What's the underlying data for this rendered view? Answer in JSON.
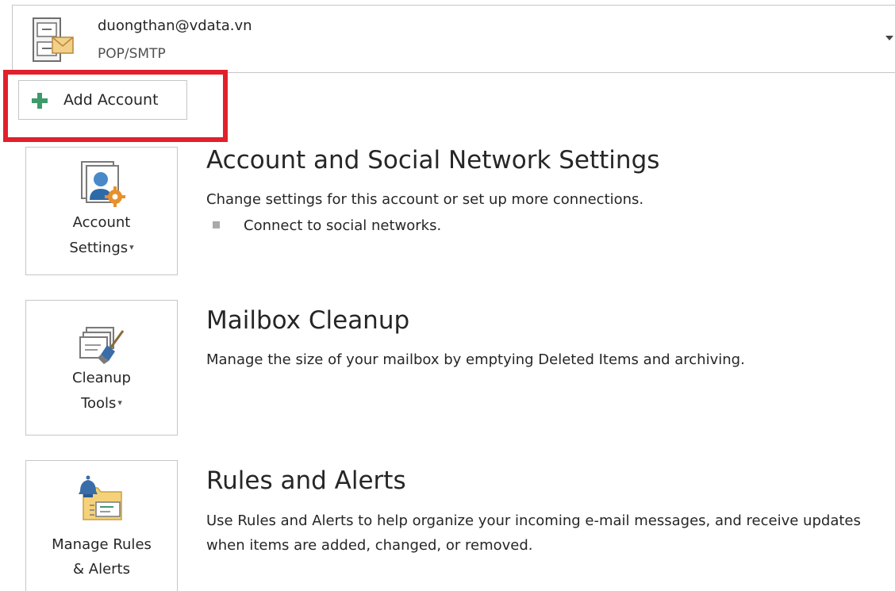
{
  "account": {
    "email": "duongthan@vdata.vn",
    "type": "POP/SMTP"
  },
  "add_account": {
    "label": "Add Account"
  },
  "sections": [
    {
      "button_label_line1": "Account",
      "button_label_line2": "Settings",
      "title": "Account and Social Network Settings",
      "description": "Change settings for this account or set up more connections.",
      "bullets": [
        "Connect to social networks."
      ]
    },
    {
      "button_label_line1": "Cleanup",
      "button_label_line2": "Tools",
      "title": "Mailbox Cleanup",
      "description": "Manage the size of your mailbox by emptying Deleted Items and archiving."
    },
    {
      "button_label_line1": "Manage Rules",
      "button_label_line2": "& Alerts",
      "title": "Rules and Alerts",
      "description": "Use Rules and Alerts to help organize your incoming e-mail messages, and receive updates when items are added, changed, or removed."
    }
  ],
  "icons": {
    "account": "filing-cabinet-mail-icon",
    "add": "plus-icon",
    "dropdown": "chevron-down-icon",
    "account_settings": "user-gear-icon",
    "cleanup_tools": "mailbox-broom-icon",
    "rules_alerts": "folder-bell-icon"
  },
  "colors": {
    "highlight": "#e2202b",
    "plus": "#3f9a6b",
    "border": "#c6c6c6"
  }
}
